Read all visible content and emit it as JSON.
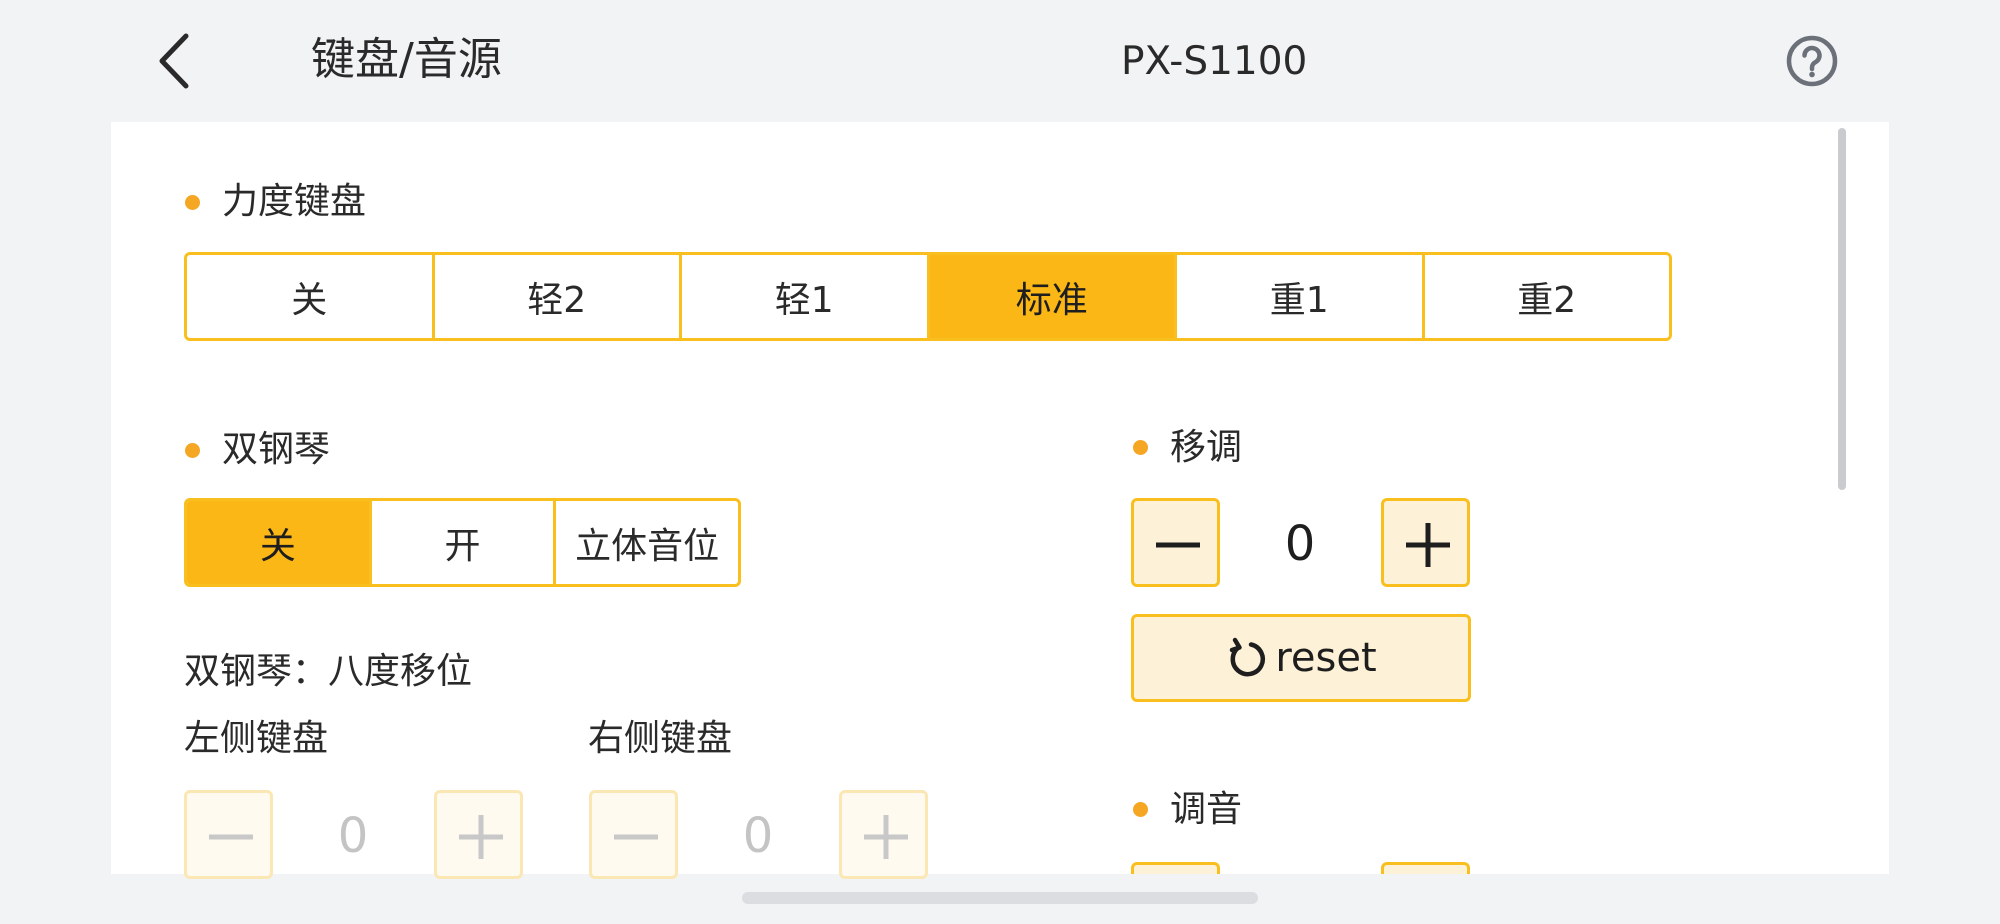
{
  "header": {
    "title": "键盘/音源",
    "device": "PX-S1100"
  },
  "colors": {
    "accent": "#fbb716",
    "accent_border": "#f9bf1f",
    "dot": "#f5a623",
    "button_fill": "#fdf1d8"
  },
  "touch": {
    "label": "力度键盘",
    "options": [
      "关",
      "轻2",
      "轻1",
      "标准",
      "重1",
      "重2"
    ],
    "selected": "标准"
  },
  "duet": {
    "label": "双钢琴",
    "options": [
      "关",
      "开",
      "立体音位"
    ],
    "selected": "关",
    "octave_label": "双钢琴：八度移位",
    "left": {
      "label": "左侧键盘",
      "value": "0"
    },
    "right": {
      "label": "右侧键盘",
      "value": "0"
    }
  },
  "transpose": {
    "label": "移调",
    "value": "0",
    "reset_label": "reset"
  },
  "tuning": {
    "label": "调音"
  }
}
